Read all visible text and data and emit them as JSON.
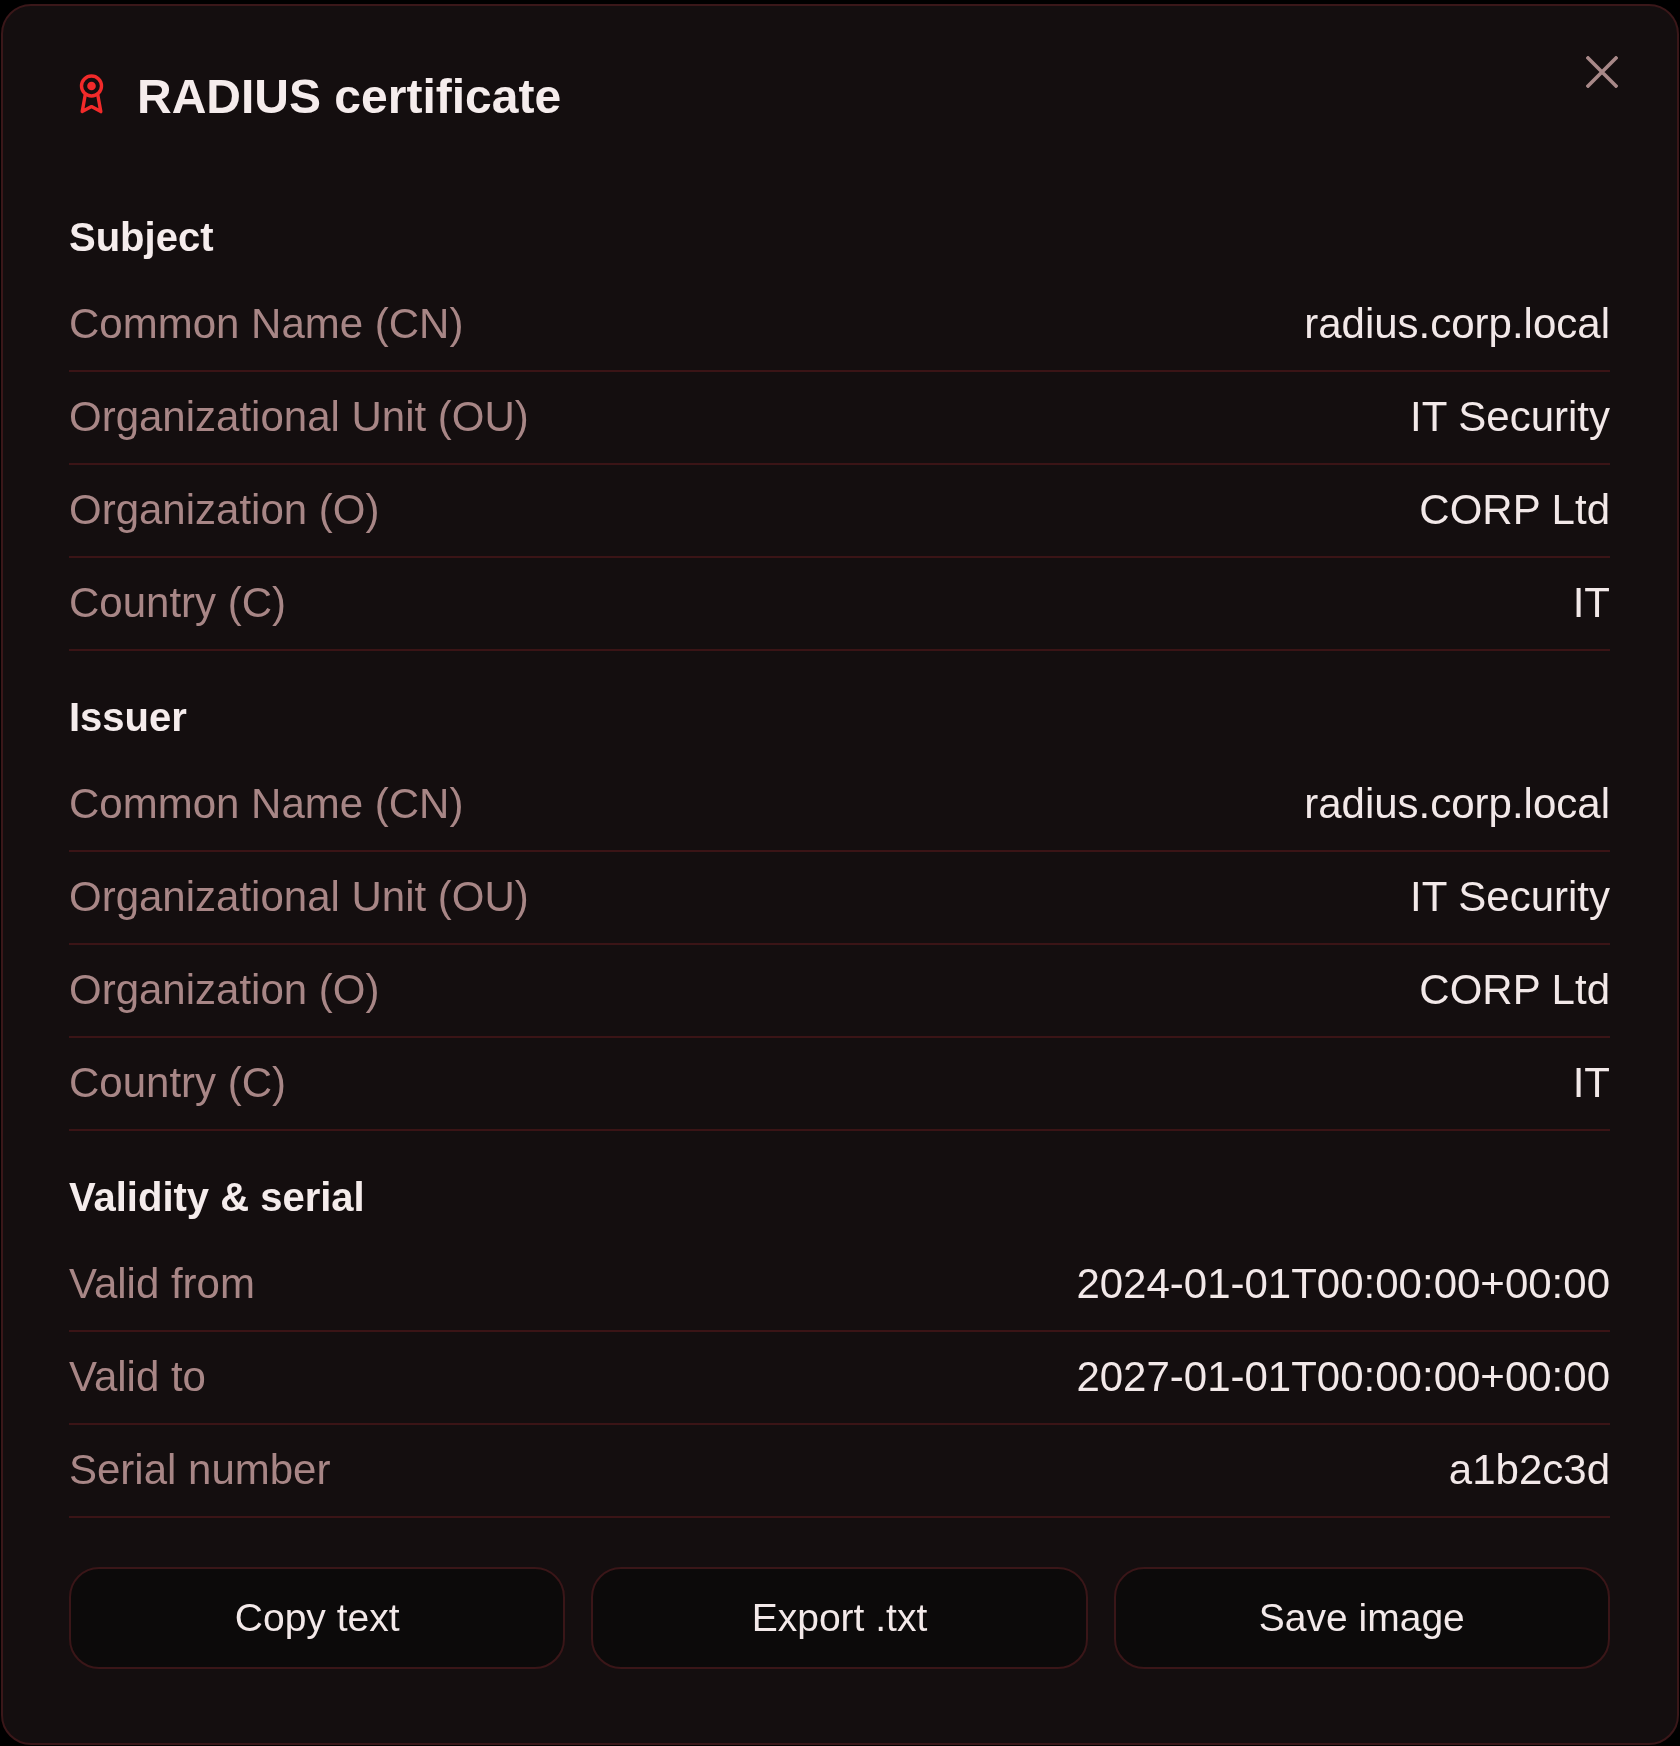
{
  "dialog": {
    "title": "RADIUS certificate",
    "sections": [
      {
        "heading": "Subject",
        "fields": [
          {
            "label": "Common Name (CN)",
            "value": "radius.corp.local"
          },
          {
            "label": "Organizational Unit (OU)",
            "value": "IT Security"
          },
          {
            "label": "Organization (O)",
            "value": "CORP Ltd"
          },
          {
            "label": "Country (C)",
            "value": "IT"
          }
        ]
      },
      {
        "heading": "Issuer",
        "fields": [
          {
            "label": "Common Name (CN)",
            "value": "radius.corp.local"
          },
          {
            "label": "Organizational Unit (OU)",
            "value": "IT Security"
          },
          {
            "label": "Organization (O)",
            "value": "CORP Ltd"
          },
          {
            "label": "Country (C)",
            "value": "IT"
          }
        ]
      },
      {
        "heading": "Validity & serial",
        "fields": [
          {
            "label": "Valid from",
            "value": "2024-01-01T00:00:00+00:00"
          },
          {
            "label": "Valid to",
            "value": "2027-01-01T00:00:00+00:00"
          },
          {
            "label": "Serial number",
            "value": "a1b2c3d"
          }
        ]
      }
    ],
    "buttons": [
      "Copy text",
      "Export .txt",
      "Save image"
    ]
  }
}
